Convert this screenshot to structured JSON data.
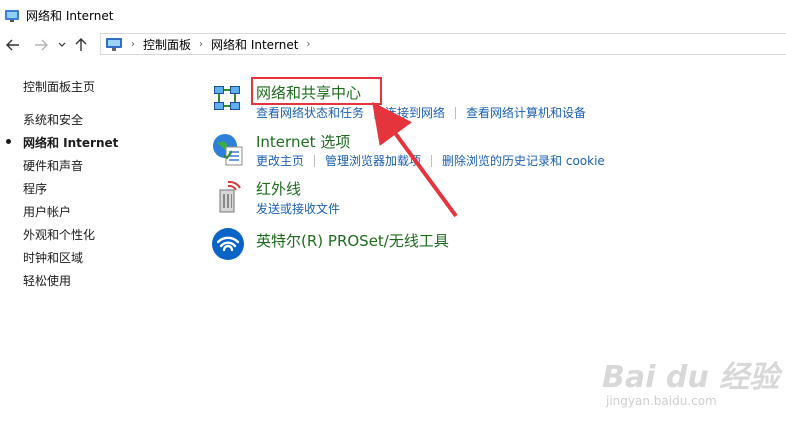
{
  "window": {
    "title": "网络和 Internet"
  },
  "address": {
    "crumbs": [
      "控制面板",
      "网络和 Internet"
    ]
  },
  "sidebar": {
    "items": [
      {
        "label": "控制面板主页"
      },
      {
        "label": "系统和安全"
      },
      {
        "label": "网络和 Internet",
        "active": true
      },
      {
        "label": "硬件和声音"
      },
      {
        "label": "程序"
      },
      {
        "label": "用户帐户"
      },
      {
        "label": "外观和个性化"
      },
      {
        "label": "时钟和区域"
      },
      {
        "label": "轻松使用"
      }
    ]
  },
  "categories": [
    {
      "title": "网络和共享中心",
      "icon": "network-sharing-icon",
      "links": [
        "查看网络状态和任务",
        "连接到网络",
        "查看网络计算机和设备"
      ]
    },
    {
      "title": "Internet 选项",
      "icon": "internet-options-icon",
      "links": [
        "更改主页",
        "管理浏览器加载项",
        "删除浏览的历史记录和 cookie"
      ]
    },
    {
      "title": "红外线",
      "icon": "infrared-icon",
      "links": [
        "发送或接收文件"
      ]
    },
    {
      "title": "英特尔(R) PROSet/无线工具",
      "icon": "intel-wireless-icon",
      "links": []
    }
  ],
  "annotation": {
    "highlight_color": "#e5343b"
  },
  "watermark": {
    "main": "Bai du 经验",
    "sub": "jingyan.baidu.com"
  },
  "colors": {
    "link": "#1b5fb2",
    "category_title": "#1e6b1e"
  }
}
